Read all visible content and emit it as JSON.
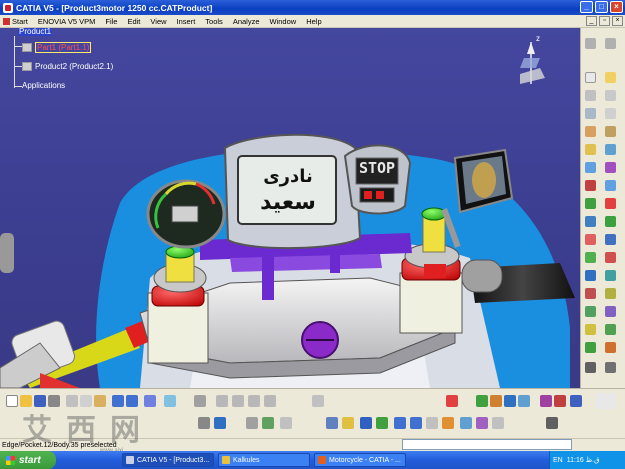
{
  "window": {
    "title": "CATIA V5 - [Product3motor  1250 cc.CATProduct]",
    "buttons": {
      "minimize": "_",
      "maximize": "□",
      "close": "×"
    }
  },
  "menubar": {
    "items": [
      "Start",
      "ENOVIA V5 VPM",
      "File",
      "Edit",
      "View",
      "Insert",
      "Tools",
      "Analyze",
      "Window",
      "Help"
    ],
    "doc_buttons": {
      "minimize": "_",
      "restore": "▫",
      "close": "×"
    }
  },
  "tree": {
    "root": "Product1",
    "items": [
      "Part1 (Part1.1)",
      "Product2 (Product2.1)"
    ],
    "applications": "Applications"
  },
  "viewport": {
    "dash_text_line1": "نادری",
    "dash_text_line2": "سعید",
    "stop_display": "STOP",
    "compass_label": "z"
  },
  "status": {
    "message": "Edge/Pocket.12/Body.35 preselected"
  },
  "taskbar": {
    "start_label": "start",
    "tasks": [
      {
        "label": "CATIA V5 - [Product3...",
        "icon_color": "#c8d0e8"
      },
      {
        "label": "Kalkules",
        "icon_color": "#e8c040"
      },
      {
        "label": "Motorcycle - CATIA - ...",
        "icon_color": "#e06020"
      }
    ],
    "tray_lang": "EN",
    "tray_time": "11:16 ق.ظ"
  },
  "watermark": {
    "text": "艾西网",
    "sub": "www.aixi"
  },
  "colors": {
    "viewport_bg": "#3b3d8f",
    "selection_red": "#ff5050",
    "toolbar_bg": "#ece9d8"
  }
}
